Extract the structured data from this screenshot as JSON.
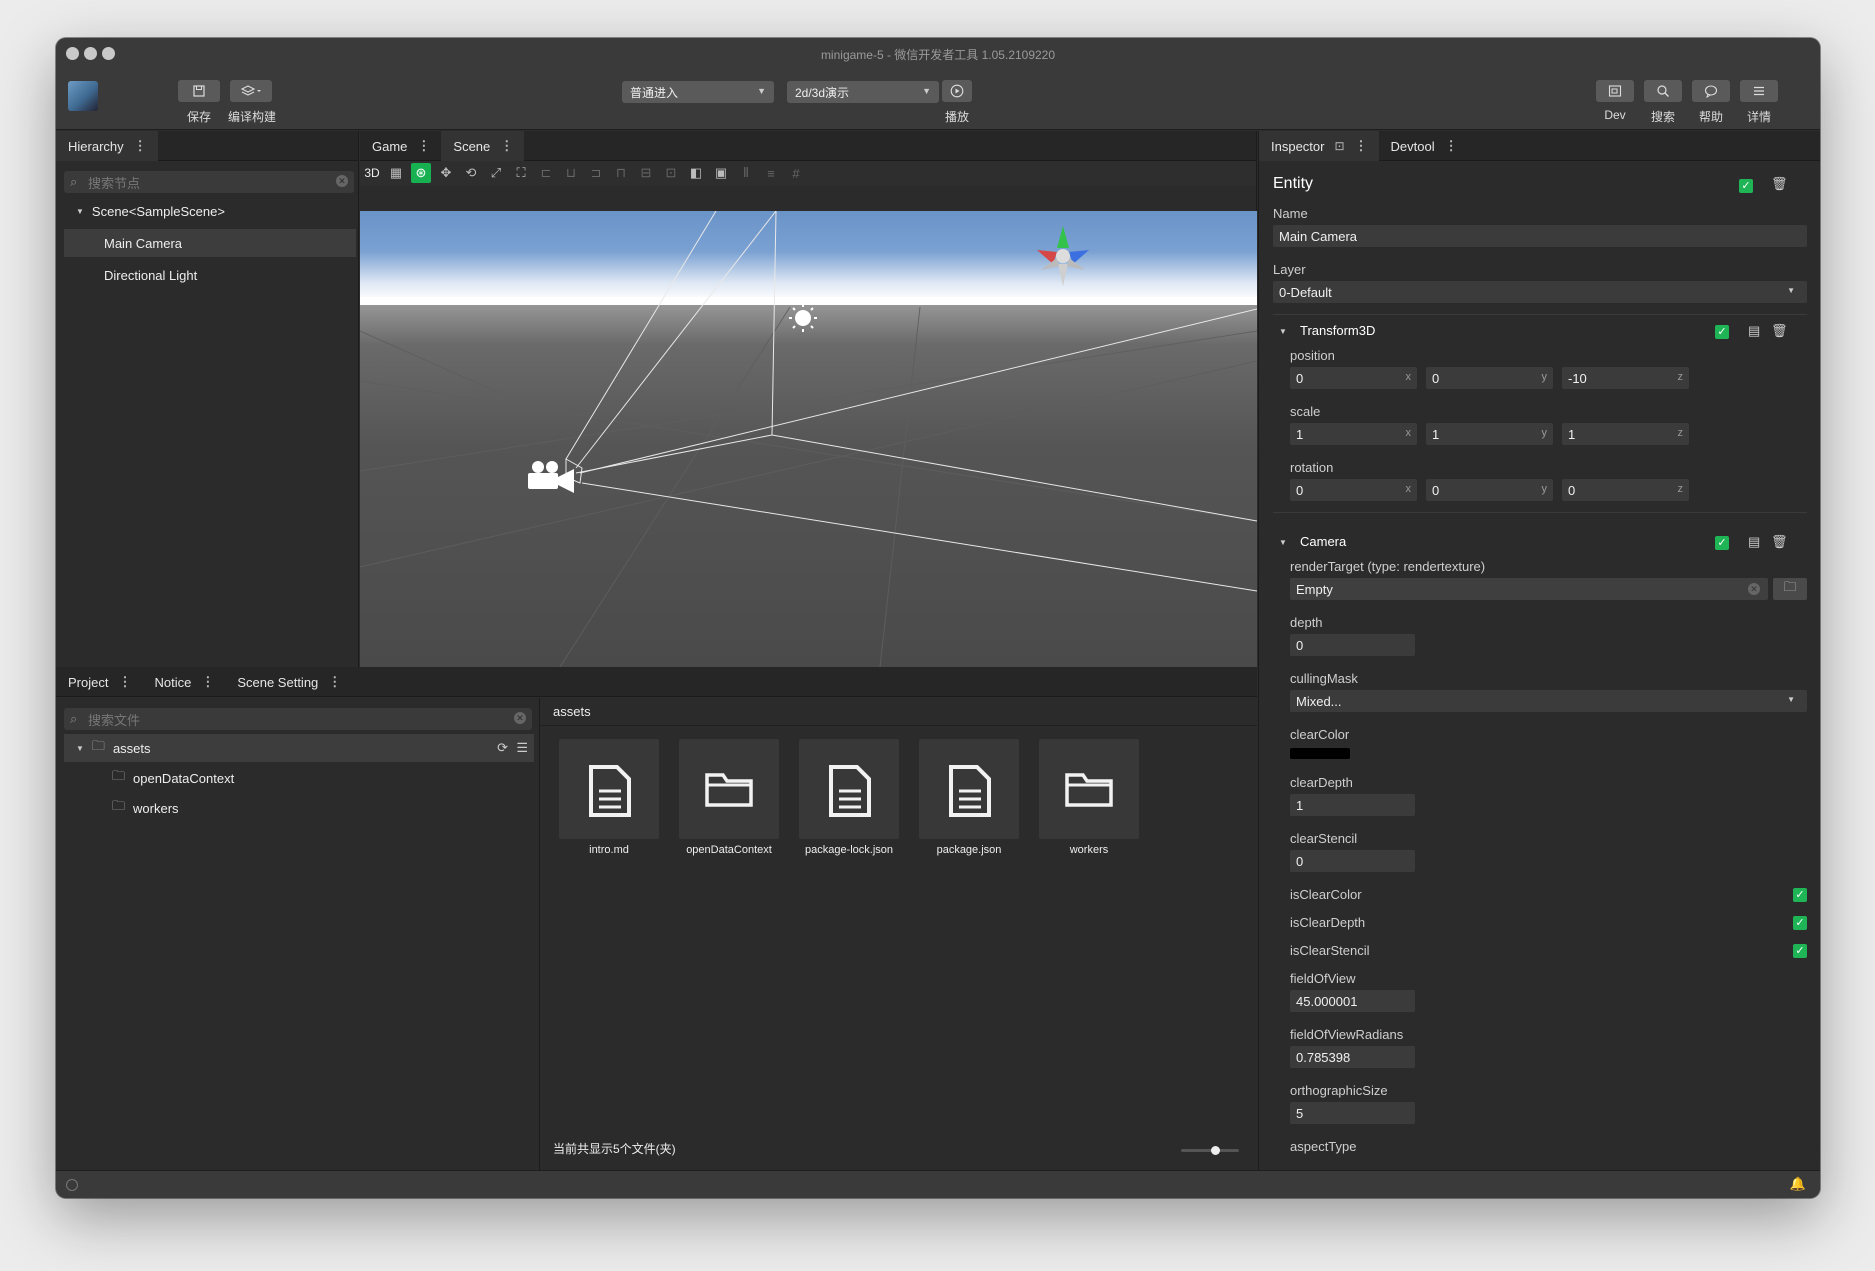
{
  "window": {
    "title": "minigame-5 - 微信开发者工具 1.05.2109220"
  },
  "toolbar": {
    "save_label": "保存",
    "build_label": "编译构建",
    "mode_select": "普通进入",
    "scene_select": "2d/3d演示",
    "play_label": "播放",
    "dev_label": "Dev",
    "search_label": "搜索",
    "help_label": "帮助",
    "details_label": "详情"
  },
  "hierarchy": {
    "tab": "Hierarchy",
    "search_placeholder": "搜索节点",
    "root": "Scene<SampleScene>",
    "items": [
      "Main Camera",
      "Directional Light"
    ]
  },
  "viewport": {
    "tabs": [
      "Game",
      "Scene"
    ],
    "mode_3d": "3D"
  },
  "project": {
    "tabs": [
      "Project",
      "Notice",
      "Scene Setting"
    ],
    "search_placeholder": "搜索文件",
    "root_folder": "assets",
    "folders": [
      "openDataContext",
      "workers"
    ],
    "path": "assets",
    "assets": [
      {
        "name": "intro.md",
        "kind": "file"
      },
      {
        "name": "openDataContext",
        "kind": "folder"
      },
      {
        "name": "package-lock.json",
        "kind": "file"
      },
      {
        "name": "package.json",
        "kind": "file"
      },
      {
        "name": "workers",
        "kind": "folder"
      }
    ],
    "footer": "当前共显示5个文件(夹)"
  },
  "inspector": {
    "tabs": [
      "Inspector",
      "Devtool"
    ],
    "entity_title": "Entity",
    "name_label": "Name",
    "name_value": "Main Camera",
    "layer_label": "Layer",
    "layer_value": "0-Default",
    "transform": {
      "title": "Transform3D",
      "position_label": "position",
      "position": [
        "0",
        "0",
        "-10"
      ],
      "scale_label": "scale",
      "scale": [
        "1",
        "1",
        "1"
      ],
      "rotation_label": "rotation",
      "rotation": [
        "0",
        "0",
        "0"
      ],
      "axes": [
        "x",
        "y",
        "z"
      ]
    },
    "camera": {
      "title": "Camera",
      "render_target_label": "renderTarget (type: rendertexture)",
      "render_target_value": "Empty",
      "depth_label": "depth",
      "depth_value": "0",
      "culling_label": "cullingMask",
      "culling_value": "Mixed...",
      "clear_color_label": "clearColor",
      "clear_color_value": "#000000",
      "clear_depth_label": "clearDepth",
      "clear_depth_value": "1",
      "clear_stencil_label": "clearStencil",
      "clear_stencil_value": "0",
      "is_clear_color_label": "isClearColor",
      "is_clear_depth_label": "isClearDepth",
      "is_clear_stencil_label": "isClearStencil",
      "fov_label": "fieldOfView",
      "fov_value": "45.000001",
      "fov_rad_label": "fieldOfViewRadians",
      "fov_rad_value": "0.785398",
      "ortho_label": "orthographicSize",
      "ortho_value": "5",
      "aspect_label": "aspectType"
    }
  },
  "colors": {
    "accent": "#1fb455",
    "panel": "#2b2b2b",
    "sky": "#6a93c8"
  }
}
